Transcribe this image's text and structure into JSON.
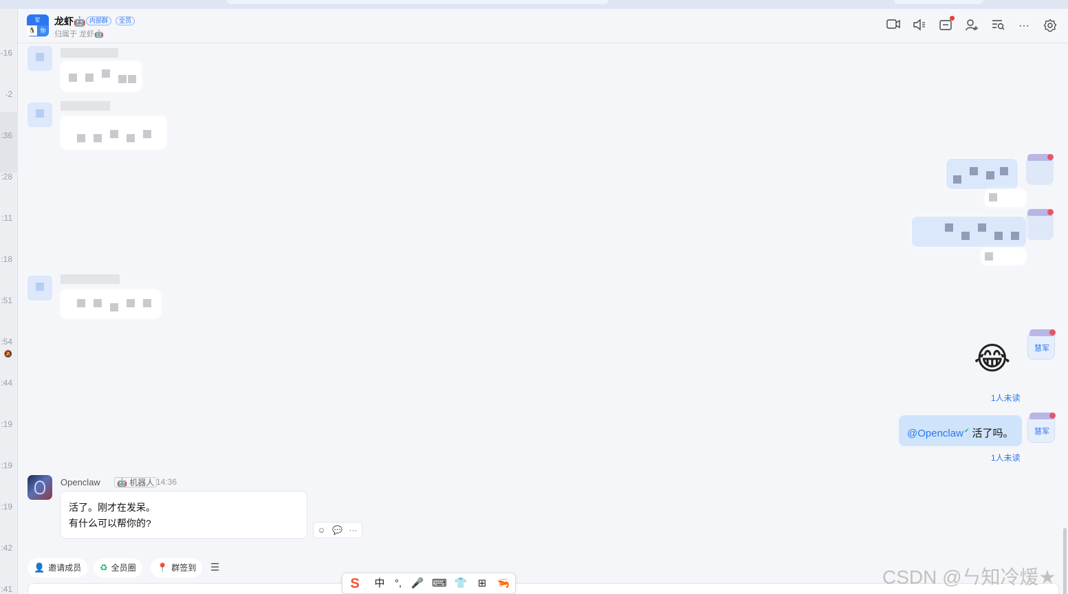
{
  "left_times": [
    "-16",
    "-2",
    ":36",
    ":28",
    ":11",
    ":18",
    ":51",
    ":54",
    ":44",
    ":19",
    ":19",
    ":19",
    ":42",
    ":41"
  ],
  "header": {
    "group_name": "龙虾🤖",
    "tag_internal": "内部群",
    "tag_all": "全员",
    "subtitle": "归属于 龙虾🤖",
    "avatar_chars": [
      "军",
      "🐧",
      "你"
    ],
    "icons": [
      "video-call-icon",
      "voice-call-icon",
      "folder-icon",
      "add-member-icon",
      "search-history-icon",
      "more-icon",
      "settings-icon"
    ]
  },
  "messages": {
    "my_avatar_name": "慧军",
    "emoji": "😂",
    "unread_label": "1人未读",
    "my_mention": "@Openclaw",
    "my_text": "活了吗。",
    "bot": {
      "name": "Openclaw",
      "badge": "机器人",
      "time": "14:36",
      "line1": "活了。刚才在发呆。",
      "line2": "有什么可以帮你的?"
    }
  },
  "toolbar": {
    "invite": "邀请成员",
    "circle": "全员圈",
    "checkin": "群签到",
    "menu": "☰"
  },
  "ime": [
    "S",
    "中",
    "°,",
    "🎤",
    "⌨",
    "👕",
    "⊞",
    "🦐"
  ],
  "watermark": "CSDN @ㄣ知冷煖★",
  "colors": {
    "accent": "#2b77ef",
    "my_bubble": "#cfe4fb"
  }
}
